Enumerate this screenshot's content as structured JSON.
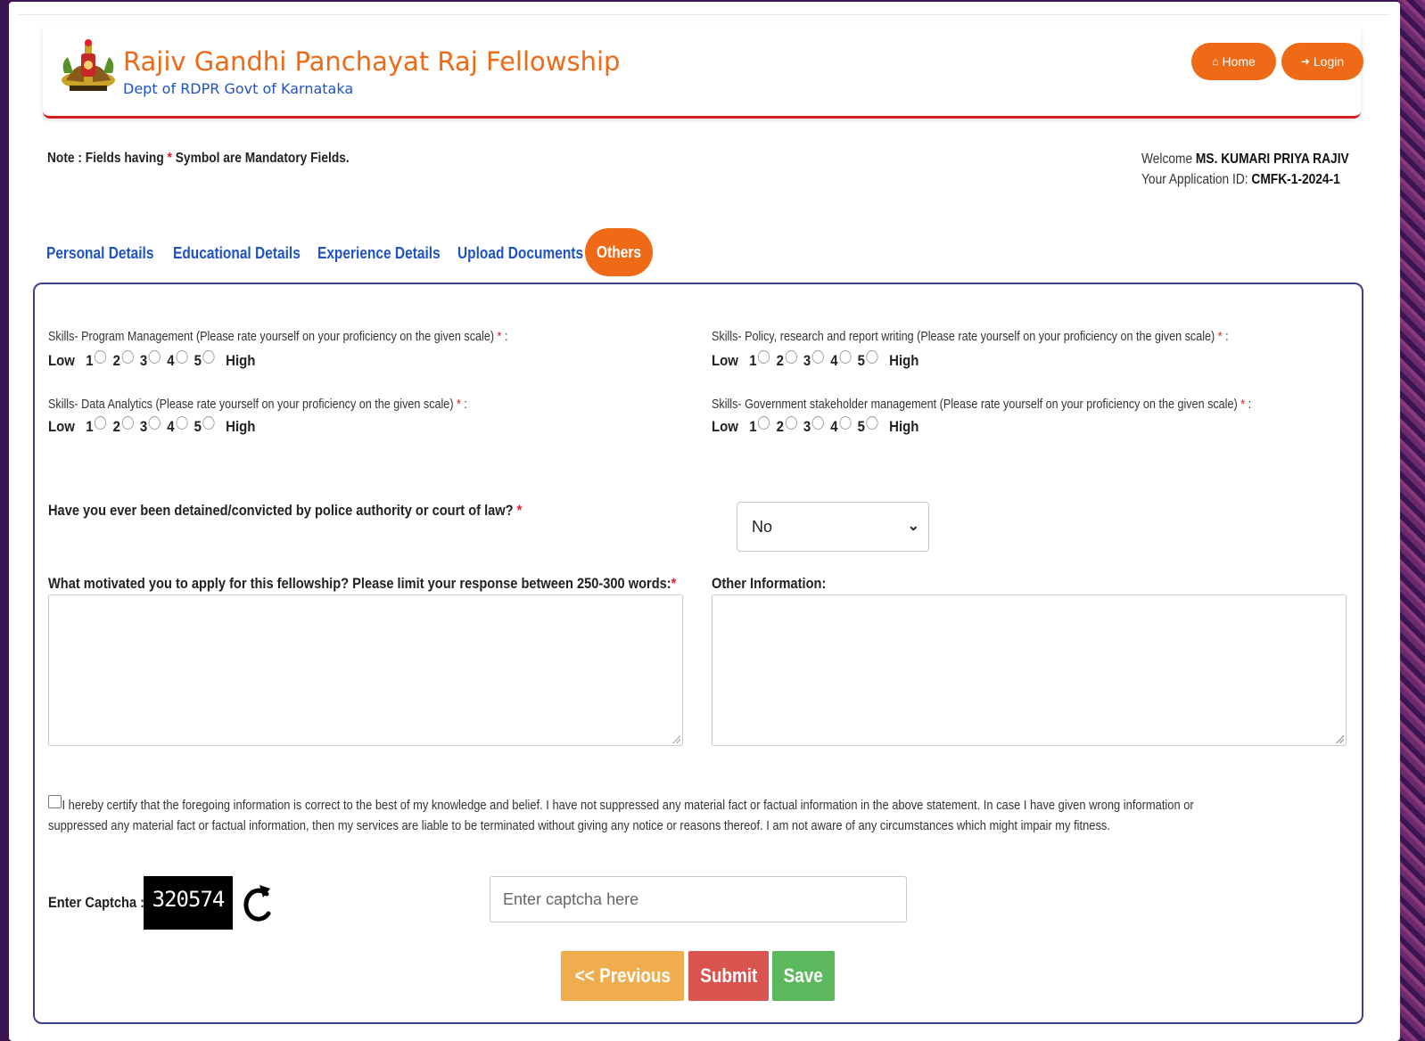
{
  "header": {
    "title": "Rajiv Gandhi Panchayat Raj Fellowship",
    "subtitle": "Dept of RDPR Govt of Karnataka",
    "home_icon": "home-icon",
    "home_label": "Home",
    "login_icon": "sign-in-icon",
    "login_label": "Login",
    "accent_color": "#ee6a17",
    "underline_color": "#d62020"
  },
  "note": {
    "prefix": "Note : Fields having ",
    "star": "*",
    "suffix": " Symbol are Mandatory Fields."
  },
  "welcome": {
    "label": "Welcome ",
    "name": "MS. KUMARI PRIYA RAJIV",
    "app_id_label": "Your Application ID: ",
    "app_id": "CMFK-1-2024-1"
  },
  "tabs": [
    {
      "label": "Personal Details",
      "active": false
    },
    {
      "label": "Educational Details",
      "active": false
    },
    {
      "label": "Experience Details",
      "active": false
    },
    {
      "label": "Upload Documents",
      "active": false
    },
    {
      "label": "Others",
      "active": true
    }
  ],
  "skills": {
    "low": "Low",
    "high": "High",
    "scale": [
      "1",
      "2",
      "3",
      "4",
      "5"
    ],
    "items": [
      {
        "label": "Skills- Program Management (Please rate yourself on your proficiency on the given scale)",
        "star": "*",
        "colon": " :"
      },
      {
        "label": "Skills- Policy, research and report writing (Please rate yourself on your proficiency on the given scale)",
        "star": "*",
        "colon": " :"
      },
      {
        "label": "Skills- Data Analytics (Please rate yourself on your proficiency on the given scale)",
        "star": "*",
        "colon": " :"
      },
      {
        "label": "Skills- Government stakeholder management (Please rate yourself on your proficiency on the given scale)",
        "star": "*",
        "colon": " :"
      }
    ]
  },
  "detained": {
    "question": "Have you ever been detained/convicted by police authority or court of law?",
    "star": " *",
    "value": "No"
  },
  "motivation": {
    "label": "What motivated you to apply for this fellowship? Please limit your response between 250-300 words:",
    "star": "*"
  },
  "other_info": {
    "label": "Other Information:"
  },
  "certify": "I hereby certify that the foregoing information is correct to the best of my knowledge and belief. I have not suppressed any material fact or factual information in the above statement. In case I have given wrong information or suppressed any material fact or factual information, then my services are liable to be terminated without giving any notice or reasons thereof. I am not aware of any circumstances which might impair my fitness.",
  "captcha": {
    "label": "Enter Captcha :",
    "code": "320574",
    "refresh_icon": "refresh-icon",
    "placeholder": "Enter captcha here"
  },
  "buttons": {
    "previous": "<< Previous",
    "submit": "Submit",
    "save": "Save"
  }
}
